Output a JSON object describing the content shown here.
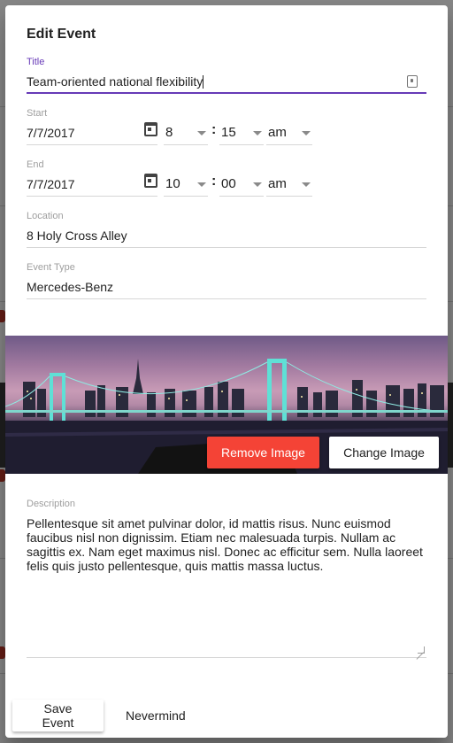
{
  "dialog": {
    "title": "Edit Event",
    "title_field": {
      "label": "Title",
      "value": "Team-oriented national flexibility"
    },
    "start": {
      "label": "Start",
      "date": "7/7/2017",
      "hour": "8",
      "minute": "15",
      "period": "am"
    },
    "end": {
      "label": "End",
      "date": "7/7/2017",
      "hour": "10",
      "minute": "00",
      "period": "am"
    },
    "location": {
      "label": "Location",
      "value": "8 Holy Cross Alley"
    },
    "event_type": {
      "label": "Event Type",
      "value": "Mercedes-Benz"
    },
    "image": {
      "remove_label": "Remove Image",
      "change_label": "Change Image"
    },
    "description": {
      "label": "Description",
      "value": "Pellentesque sit amet pulvinar dolor, id mattis risus. Nunc euismod faucibus nisl non dignissim. Etiam nec malesuada turpis. Nullam ac sagittis ex. Nam eget maximus nisl. Donec ac efficitur sem. Nulla laoreet felis quis justo pellentesque, quis mattis massa luctus."
    },
    "actions": {
      "save_label": "Save Event",
      "cancel_label": "Nevermind"
    }
  },
  "colors": {
    "accent": "#673ab7",
    "danger": "#f44336"
  },
  "icons": {
    "contact": "contact-card-icon",
    "calendar": "calendar-icon",
    "dropdown": "chevron-down-icon"
  }
}
